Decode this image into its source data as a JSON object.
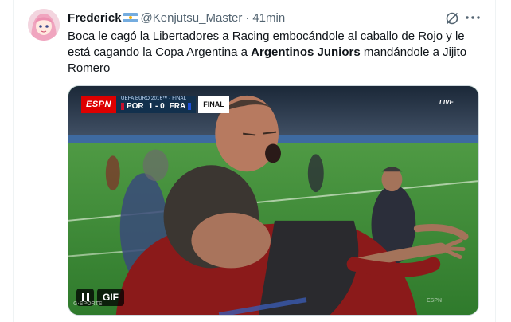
{
  "tweet": {
    "author": {
      "name": "Frederick",
      "handle": "@Kenjutsu_Master",
      "separator": "·",
      "time": "41min"
    },
    "text": {
      "line1": "Boca le cagó la Libertadores a Racing embocándole al caballo de Rojo y le",
      "line2_before": "está cagando la Copa Argentina a ",
      "line2_bold": "Argentinos Juniors",
      "line2_after": " mandándole a Jijito",
      "line3": "Romero"
    },
    "media": {
      "scorebug": {
        "network": "ESPN",
        "competition": "UEFA EURO 2016™ - FINAL",
        "home": "POR",
        "score": "1 - 0",
        "away": "FRA",
        "status": "FINAL"
      },
      "live_tag": "LIVE",
      "gif_label": "GIF",
      "watermark_left": "G·SPORTS",
      "watermark_right": "ESPN"
    }
  },
  "icons": [
    "flag-argentina-icon",
    "grok-icon",
    "more-icon",
    "pause-icon"
  ],
  "colors": {
    "text_primary": "#0f1419",
    "text_secondary": "#536471",
    "border": "#cfd9de",
    "espn_red": "#dd0000",
    "scorebar_blue": "#12304d"
  }
}
